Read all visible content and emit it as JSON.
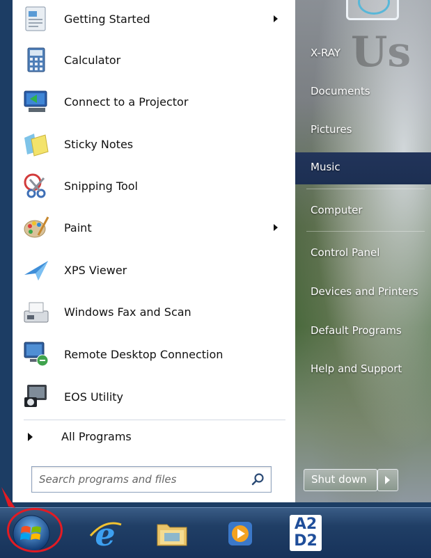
{
  "start_menu": {
    "programs": [
      {
        "label": "Getting Started",
        "icon": "getting-started-icon",
        "has_submenu": true
      },
      {
        "label": "Calculator",
        "icon": "calculator-icon",
        "has_submenu": false
      },
      {
        "label": "Connect to a Projector",
        "icon": "projector-icon",
        "has_submenu": false
      },
      {
        "label": "Sticky Notes",
        "icon": "sticky-notes-icon",
        "has_submenu": false
      },
      {
        "label": "Snipping Tool",
        "icon": "snipping-tool-icon",
        "has_submenu": false
      },
      {
        "label": "Paint",
        "icon": "paint-palette-icon",
        "has_submenu": true
      },
      {
        "label": "XPS Viewer",
        "icon": "xps-viewer-icon",
        "has_submenu": false
      },
      {
        "label": "Windows Fax and Scan",
        "icon": "fax-scan-icon",
        "has_submenu": false
      },
      {
        "label": "Remote Desktop Connection",
        "icon": "remote-desktop-icon",
        "has_submenu": false
      },
      {
        "label": "EOS Utility",
        "icon": "eos-utility-icon",
        "has_submenu": false
      }
    ],
    "all_programs_label": "All Programs",
    "search": {
      "placeholder": "Search programs and files"
    },
    "right_pane": {
      "places": [
        {
          "label": "X-RAY",
          "highlighted": false
        },
        {
          "label": "Documents",
          "highlighted": false
        },
        {
          "label": "Pictures",
          "highlighted": false
        },
        {
          "label": "Music",
          "highlighted": true
        },
        {
          "label": "Computer",
          "highlighted": false
        },
        {
          "label": "Control Panel",
          "highlighted": false
        },
        {
          "label": "Devices and Printers",
          "highlighted": false
        },
        {
          "label": "Default Programs",
          "highlighted": false
        },
        {
          "label": "Help and Support",
          "highlighted": false
        }
      ],
      "shutdown_label": "Shut down"
    }
  },
  "taskbar": {
    "items": [
      {
        "name": "start-orb",
        "icon": "windows-logo-icon"
      },
      {
        "name": "internet-explorer",
        "icon": "internet-explorer-icon"
      },
      {
        "name": "windows-explorer",
        "icon": "folder-icon"
      },
      {
        "name": "media-player",
        "icon": "media-player-icon"
      },
      {
        "name": "a2d2",
        "icon": "a2d2-icon",
        "text_top": "A2",
        "text_bottom": "D2"
      }
    ]
  },
  "colors": {
    "highlight_ring": "#e31b23",
    "taskbar": "#1c3d64",
    "selected_place": "#1f3156"
  }
}
